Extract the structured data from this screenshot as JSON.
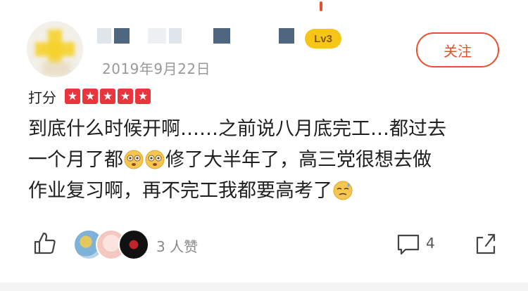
{
  "user": {
    "level_badge": "Lv3",
    "follow_label": "关注",
    "review_date": "2019年9月22日"
  },
  "rating": {
    "label": "打分",
    "stars": 5,
    "star_color": "#e8363c"
  },
  "review": {
    "line1": "到底什么时候开啊……之前说八月底完工…都过去",
    "line2_a": "一个月了都",
    "line2_b": "修了大半年了，高三党很想去做",
    "line3": "作业复习啊，再不完工我都要高考了",
    "emojis": [
      "dizzy-face-emoji",
      "dizzy-face-emoji",
      "sweat-face-emoji"
    ]
  },
  "actions": {
    "likes_label": "3 人赞",
    "comment_count": "4",
    "icons": [
      "thumbs-up-icon",
      "comment-icon",
      "share-icon"
    ]
  },
  "colors": {
    "accent": "#e8502d",
    "level": "#f5c518",
    "muted": "#999999"
  }
}
